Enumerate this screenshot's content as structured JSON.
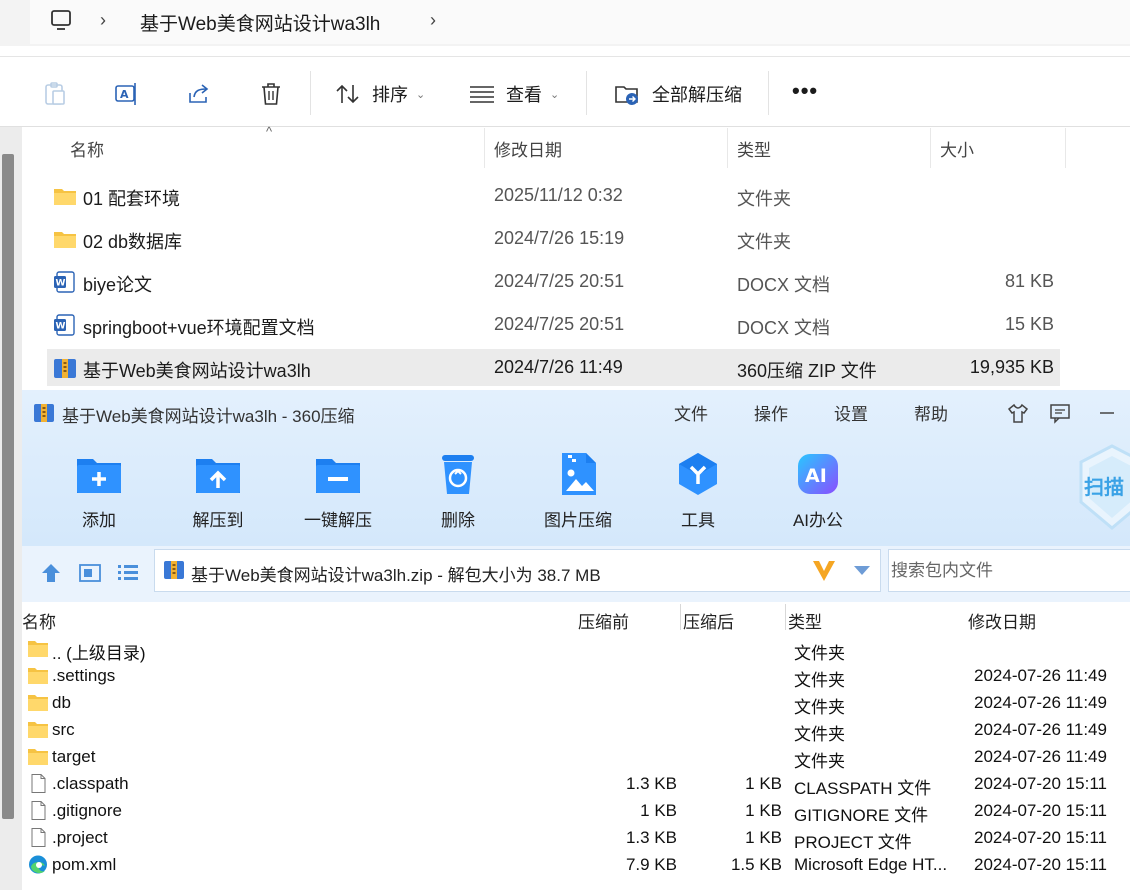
{
  "explorer": {
    "breadcrumb": "基于Web美食网站设计wa3lh",
    "toolbar": {
      "sort_label": "排序",
      "view_label": "查看",
      "extract_all_label": "全部解压缩",
      "more_label": "•••"
    },
    "columns": {
      "name": "名称",
      "modified": "修改日期",
      "type": "类型",
      "size": "大小"
    },
    "rows": [
      {
        "icon": "folder-icon",
        "name": "01 配套环境",
        "modified": "2025/11/12 0:32",
        "type": "文件夹",
        "size": ""
      },
      {
        "icon": "folder-icon",
        "name": "02 db数据库",
        "modified": "2024/7/26 15:19",
        "type": "文件夹",
        "size": ""
      },
      {
        "icon": "word-doc-icon",
        "name": "biye论文",
        "modified": "2024/7/25 20:51",
        "type": "DOCX 文档",
        "size": "81 KB"
      },
      {
        "icon": "word-doc-icon",
        "name": "springboot+vue环境配置文档",
        "modified": "2024/7/25 20:51",
        "type": "DOCX 文档",
        "size": "15 KB"
      },
      {
        "icon": "zip-archive-icon",
        "name": "基于Web美食网站设计wa3lh",
        "modified": "2024/7/26 11:49",
        "type": "360压缩 ZIP 文件",
        "size": "19,935 KB"
      }
    ]
  },
  "zip": {
    "title": "基于Web美食网站设计wa3lh - 360压缩",
    "menu": {
      "file": "文件",
      "ops": "操作",
      "settings": "设置",
      "help": "帮助"
    },
    "tools": [
      {
        "icon": "add-folder-icon",
        "label": "添加"
      },
      {
        "icon": "extract-to-icon",
        "label": "解压到"
      },
      {
        "icon": "one-click-extract-icon",
        "label": "一键解压"
      },
      {
        "icon": "delete-bin-icon",
        "label": "删除"
      },
      {
        "icon": "image-compress-icon",
        "label": "图片压缩"
      },
      {
        "icon": "tools-icon",
        "label": "工具"
      },
      {
        "icon": "ai-office-icon",
        "label": "AI办公"
      }
    ],
    "scan_label": "扫描",
    "path_text": "基于Web美食网站设计wa3lh.zip - 解包大小为 38.7 MB",
    "search_placeholder": "搜索包内文件",
    "columns": {
      "name": "名称",
      "before": "压缩前",
      "after": "压缩后",
      "type": "类型",
      "modified": "修改日期"
    },
    "rows": [
      {
        "icon": "folder-icon",
        "name": ".. (上级目录)",
        "before": "",
        "after": "",
        "type": "文件夹",
        "modified": ""
      },
      {
        "icon": "folder-icon",
        "name": ".settings",
        "before": "",
        "after": "",
        "type": "文件夹",
        "modified": "2024-07-26 11:49"
      },
      {
        "icon": "folder-icon",
        "name": "db",
        "before": "",
        "after": "",
        "type": "文件夹",
        "modified": "2024-07-26 11:49"
      },
      {
        "icon": "folder-icon",
        "name": "src",
        "before": "",
        "after": "",
        "type": "文件夹",
        "modified": "2024-07-26 11:49"
      },
      {
        "icon": "folder-icon",
        "name": "target",
        "before": "",
        "after": "",
        "type": "文件夹",
        "modified": "2024-07-26 11:49"
      },
      {
        "icon": "file-icon",
        "name": ".classpath",
        "before": "1.3 KB",
        "after": "1 KB",
        "type": "CLASSPATH 文件",
        "modified": "2024-07-20 15:11"
      },
      {
        "icon": "file-icon",
        "name": ".gitignore",
        "before": "1 KB",
        "after": "1 KB",
        "type": "GITIGNORE 文件",
        "modified": "2024-07-20 15:11"
      },
      {
        "icon": "file-icon",
        "name": ".project",
        "before": "1.3 KB",
        "after": "1 KB",
        "type": "PROJECT 文件",
        "modified": "2024-07-20 15:11"
      },
      {
        "icon": "edge-icon",
        "name": "pom.xml",
        "before": "7.9 KB",
        "after": "1.5 KB",
        "type": "Microsoft Edge HT...",
        "modified": "2024-07-20 15:11"
      }
    ]
  }
}
